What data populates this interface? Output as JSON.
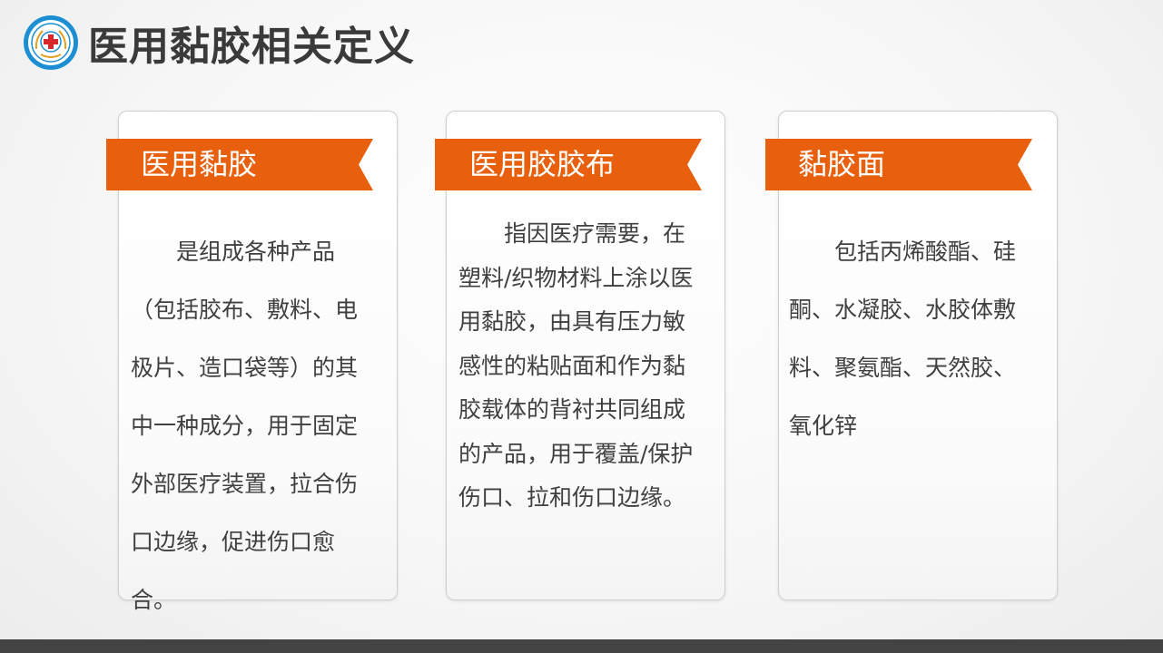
{
  "page": {
    "title": "医用黏胶相关定义"
  },
  "colors": {
    "accent": "#e8600d",
    "title_text": "#3a3a3a",
    "body_text": "#404040",
    "footer_bar": "#434343"
  },
  "cards": [
    {
      "heading": "医用黏胶",
      "body": "是组成各种产品（包括胶布、敷料、电极片、造口袋等）的其中一种成分，用于固定外部医疗装置，拉合伤口边缘，促进伤口愈合。"
    },
    {
      "heading": "医用胶胶布",
      "body": "指因医疗需要，在塑料/织物材料上涂以医用黏胶，由具有压力敏感性的粘贴面和作为黏胶载体的背衬共同组成的产品，用于覆盖/保护伤口、拉和伤口边缘。"
    },
    {
      "heading": "黏胶面",
      "body": "包括丙烯酸酯、硅酮、水凝胶、水胶体敷料、聚氨酯、天然胶、氧化锌"
    }
  ]
}
